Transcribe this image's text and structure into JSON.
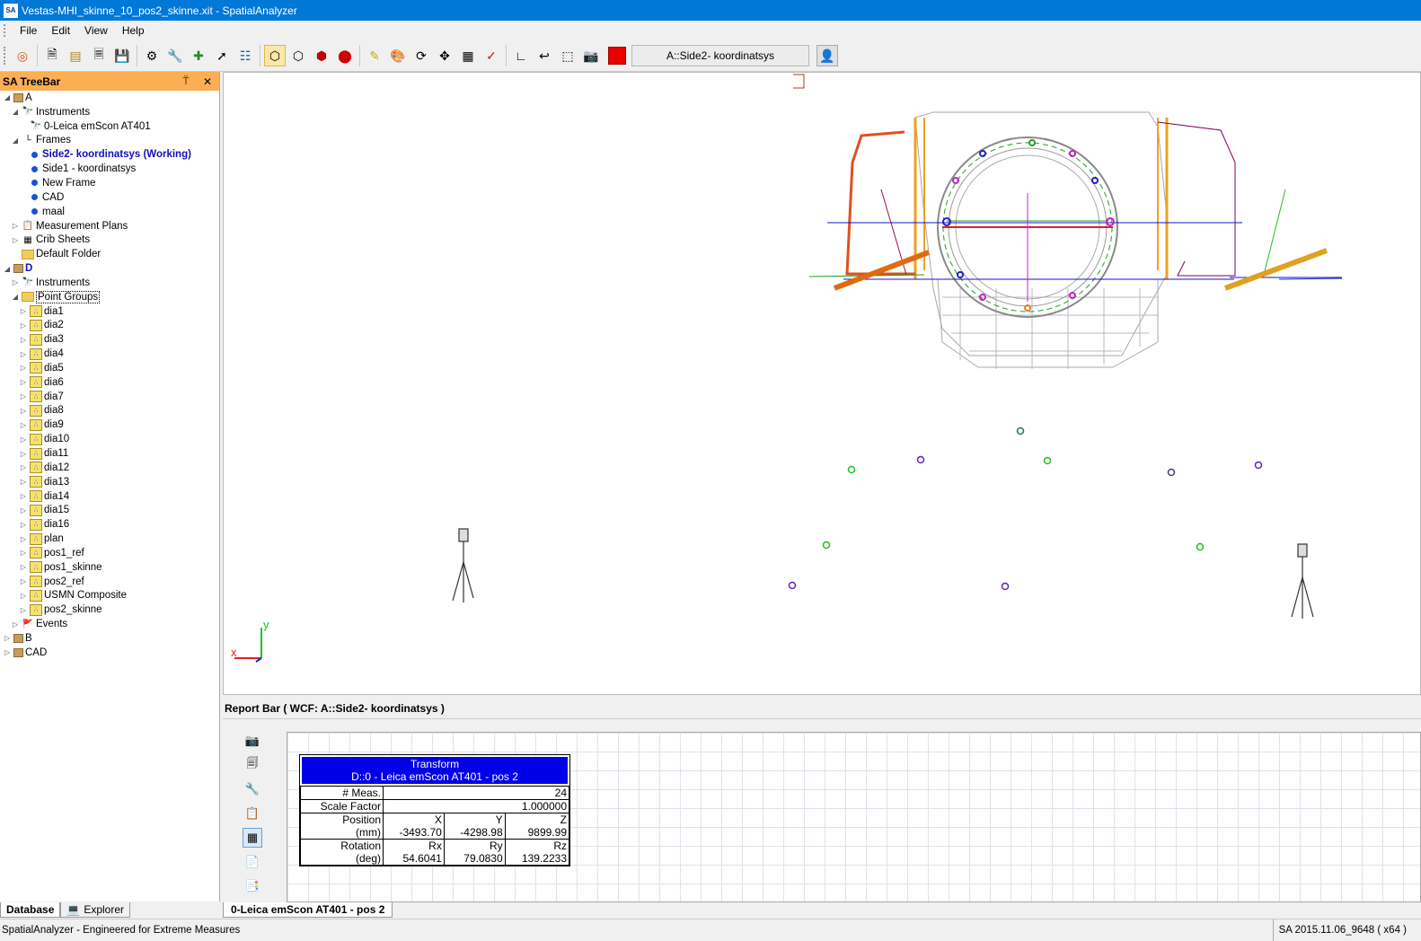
{
  "window": {
    "title": "Vestas-MHI_skinne_10_pos2_skinne.xit - SpatialAnalyzer",
    "logo": "SA"
  },
  "menu": [
    "File",
    "Edit",
    "View",
    "Help"
  ],
  "toolbar": {
    "frame_selector": "A::Side2- koordinatsys",
    "active_color": "#e60000",
    "icons": [
      "lifebuoy-icon",
      "new-document-icon",
      "open-icon",
      "save-as-icon",
      "save-icon",
      "gear-icon",
      "wrench-icon",
      "add-instrument-icon",
      "measure-icon",
      "network-icon",
      "wireframe-cube-icon",
      "outline-cube-icon",
      "solid-red-cube-icon",
      "red-sphere-icon",
      "highlight-icon",
      "palette-icon",
      "rotate-icon",
      "pan-icon",
      "view-dropdown-icon",
      "pick-icon",
      "frame-axes-icon",
      "snapshot-icon",
      "select-box-icon",
      "camera-icon"
    ]
  },
  "treebar": {
    "title": "SA TreeBar",
    "pin": "⍡",
    "close": "✕",
    "items": [
      {
        "level": 0,
        "exp": "◢",
        "icon": "box",
        "label": "A",
        "style": ""
      },
      {
        "level": 1,
        "exp": "◢",
        "icon": "instrument",
        "label": "Instruments",
        "style": ""
      },
      {
        "level": 2,
        "exp": "",
        "icon": "instrument",
        "label": "0-Leica emScon AT401",
        "style": ""
      },
      {
        "level": 1,
        "exp": "◢",
        "icon": "frames",
        "label": "Frames",
        "style": ""
      },
      {
        "level": 2,
        "exp": "",
        "icon": "dot",
        "label": "Side2- koordinatsys (Working)",
        "style": "bold-blue"
      },
      {
        "level": 2,
        "exp": "",
        "icon": "dot",
        "label": "Side1 - koordinatsys",
        "style": ""
      },
      {
        "level": 2,
        "exp": "",
        "icon": "dot",
        "label": "New Frame",
        "style": ""
      },
      {
        "level": 2,
        "exp": "",
        "icon": "dot",
        "label": "CAD",
        "style": ""
      },
      {
        "level": 2,
        "exp": "",
        "icon": "dot",
        "label": "maal",
        "style": ""
      },
      {
        "level": 1,
        "exp": "▷",
        "icon": "plans",
        "label": "Measurement Plans",
        "style": ""
      },
      {
        "level": 1,
        "exp": "▷",
        "icon": "sheet",
        "label": "Crib Sheets",
        "style": ""
      },
      {
        "level": 1,
        "exp": "",
        "icon": "folder",
        "label": "Default Folder",
        "style": ""
      },
      {
        "level": 0,
        "exp": "◢",
        "icon": "box",
        "label": "D",
        "style": "bold-blue-plain"
      },
      {
        "level": 1,
        "exp": "▷",
        "icon": "instrument",
        "label": "Instruments",
        "style": ""
      },
      {
        "level": 1,
        "exp": "◢",
        "icon": "folder",
        "label": "Point Groups",
        "style": "boxed"
      },
      {
        "level": 2,
        "exp": "▷",
        "icon": "pg",
        "label": "dia1",
        "style": ""
      },
      {
        "level": 2,
        "exp": "▷",
        "icon": "pg",
        "label": "dia2",
        "style": ""
      },
      {
        "level": 2,
        "exp": "▷",
        "icon": "pg",
        "label": "dia3",
        "style": ""
      },
      {
        "level": 2,
        "exp": "▷",
        "icon": "pg",
        "label": "dia4",
        "style": ""
      },
      {
        "level": 2,
        "exp": "▷",
        "icon": "pg",
        "label": "dia5",
        "style": ""
      },
      {
        "level": 2,
        "exp": "▷",
        "icon": "pg",
        "label": "dia6",
        "style": ""
      },
      {
        "level": 2,
        "exp": "▷",
        "icon": "pg",
        "label": "dia7",
        "style": ""
      },
      {
        "level": 2,
        "exp": "▷",
        "icon": "pg",
        "label": "dia8",
        "style": ""
      },
      {
        "level": 2,
        "exp": "▷",
        "icon": "pg",
        "label": "dia9",
        "style": ""
      },
      {
        "level": 2,
        "exp": "▷",
        "icon": "pg",
        "label": "dia10",
        "style": ""
      },
      {
        "level": 2,
        "exp": "▷",
        "icon": "pg",
        "label": "dia11",
        "style": ""
      },
      {
        "level": 2,
        "exp": "▷",
        "icon": "pg",
        "label": "dia12",
        "style": ""
      },
      {
        "level": 2,
        "exp": "▷",
        "icon": "pg",
        "label": "dia13",
        "style": ""
      },
      {
        "level": 2,
        "exp": "▷",
        "icon": "pg",
        "label": "dia14",
        "style": ""
      },
      {
        "level": 2,
        "exp": "▷",
        "icon": "pg",
        "label": "dia15",
        "style": ""
      },
      {
        "level": 2,
        "exp": "▷",
        "icon": "pg",
        "label": "dia16",
        "style": ""
      },
      {
        "level": 2,
        "exp": "▷",
        "icon": "pg",
        "label": "plan",
        "style": ""
      },
      {
        "level": 2,
        "exp": "▷",
        "icon": "pg",
        "label": "pos1_ref",
        "style": ""
      },
      {
        "level": 2,
        "exp": "▷",
        "icon": "pg",
        "label": "pos1_skinne",
        "style": ""
      },
      {
        "level": 2,
        "exp": "▷",
        "icon": "pg",
        "label": "pos2_ref",
        "style": ""
      },
      {
        "level": 2,
        "exp": "▷",
        "icon": "pg",
        "label": "USMN Composite",
        "style": ""
      },
      {
        "level": 2,
        "exp": "▷",
        "icon": "pg",
        "label": "pos2_skinne",
        "style": ""
      },
      {
        "level": 1,
        "exp": "▷",
        "icon": "flag",
        "label": "Events",
        "style": ""
      },
      {
        "level": 0,
        "exp": "▷",
        "icon": "box",
        "label": "B",
        "style": ""
      },
      {
        "level": 0,
        "exp": "▷",
        "icon": "box",
        "label": "CAD",
        "style": ""
      }
    ],
    "tabs": [
      "Database",
      "Explorer"
    ]
  },
  "viewport": {
    "axis_labels": {
      "x": "x",
      "y": "y"
    }
  },
  "reportbar": {
    "title": "Report Bar ( WCF: A::Side2- koordinatsys )",
    "transform": {
      "title": "Transform",
      "subtitle": "D::0 - Leica emScon AT401 - pos 2",
      "meas_label": "# Meas.",
      "meas_value": "24",
      "scale_label": "Scale Factor",
      "scale_value": "1.000000",
      "position_label": "Position",
      "position_unit": "(mm)",
      "pos_headers": [
        "X",
        "Y",
        "Z"
      ],
      "pos_values": [
        "-3493.70",
        "-4298.98",
        "9899.99"
      ],
      "rotation_label": "Rotation",
      "rotation_unit": "(deg)",
      "rot_headers": [
        "Rx",
        "Ry",
        "Rz"
      ],
      "rot_values": [
        "54.6041",
        "79.0830",
        "139.2233"
      ]
    },
    "tab": "0-Leica emScon AT401 - pos 2"
  },
  "status": {
    "left": "SpatialAnalyzer - Engineered for Extreme Measures",
    "right": "SA 2015.11.06_9648 ( x64 )"
  }
}
